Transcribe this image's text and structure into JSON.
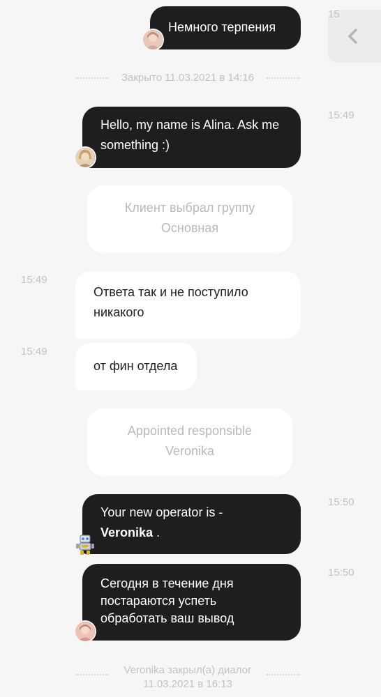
{
  "messages": {
    "m1": {
      "text": "Немного терпения",
      "time": "15"
    },
    "m2": {
      "text": "Hello, my name is Alina. Ask me something :)",
      "time": "15:49"
    },
    "m3": {
      "text": "Ответа так и не поступило никакого",
      "time": "15:49"
    },
    "m4": {
      "text": "от фин отдела",
      "time": "15:49"
    },
    "m5": {
      "text_prefix": "Your new operator is -",
      "operator": "Veronika",
      "text_suffix": ".",
      "time": "15:50"
    },
    "m6": {
      "text": "Сегодня в течение дня постараются успеть обработать ваш вывод",
      "time": "15:50"
    }
  },
  "separators": {
    "closed": "Закрыто 11.03.2021 в 14:16",
    "closed_by_line1": "Veronika закрыл(а) диалог",
    "closed_by_line2": "11.03.2021 в 16:13"
  },
  "system": {
    "group_line1": "Клиент выбрал группу",
    "group_line2": "Основная",
    "resp_line1": "Appointed responsible",
    "resp_line2": "Veronika"
  },
  "icons": {
    "back": "chevron-left-icon",
    "bot": "robot-icon"
  },
  "colors": {
    "background": "#f5f6f5",
    "outgoing_bubble": "#1e1e1e",
    "incoming_bubble": "#ffffff",
    "muted_text": "#b9b9b9"
  }
}
